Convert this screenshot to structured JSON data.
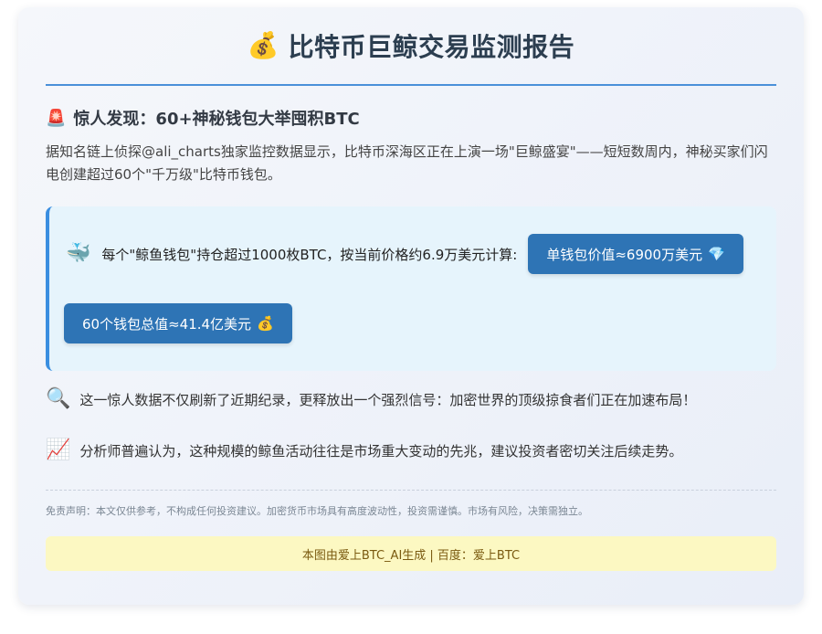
{
  "header": {
    "icon": "money-bag-icon",
    "icon_glyph": "💰",
    "title": "比特币巨鲸交易监测报告"
  },
  "section": {
    "icon": "siren-icon",
    "icon_glyph": "🚨",
    "heading": "惊人发现：60+神秘钱包大举囤积BTC"
  },
  "intro": "据知名链上侦探@ali_charts独家监控数据显示，比特币深海区正在上演一场\"巨鲸盛宴\"——短短数周内，神秘买家们闪电创建超过60个\"千万级\"比特币钱包。",
  "highlight": {
    "icon": "whale-icon",
    "icon_glyph": "🐳",
    "text": "每个\"鲸鱼钱包\"持仓超过1000枚BTC，按当前价格约6.9万美元计算:",
    "pill_1": "单钱包价值≈6900万美元",
    "pill_1_icon": "gem-icon",
    "pill_1_glyph": "💎",
    "pill_2": "60个钱包总值≈41.4亿美元",
    "pill_2_icon": "money-bag-icon",
    "pill_2_glyph": "💰"
  },
  "paragraphs": [
    {
      "icon": "magnifier-icon",
      "icon_glyph": "🔍",
      "text": "这一惊人数据不仅刷新了近期纪录，更释放出一个强烈信号：加密世界的顶级掠食者们正在加速布局！"
    },
    {
      "icon": "chart-increasing-icon",
      "icon_glyph": "📈",
      "text": "分析师普遍认为，这种规模的鲸鱼活动往往是市场重大变动的先兆，建议投资者密切关注后续走势。"
    }
  ],
  "disclaimer": "免责声明：本文仅供参考，不构成任何投资建议。加密货币市场具有高度波动性，投资需谨慎。市场有风险，决策需独立。",
  "footer_note": "本图由爱上BTC_AI生成 | 百度：爱上BTC"
}
